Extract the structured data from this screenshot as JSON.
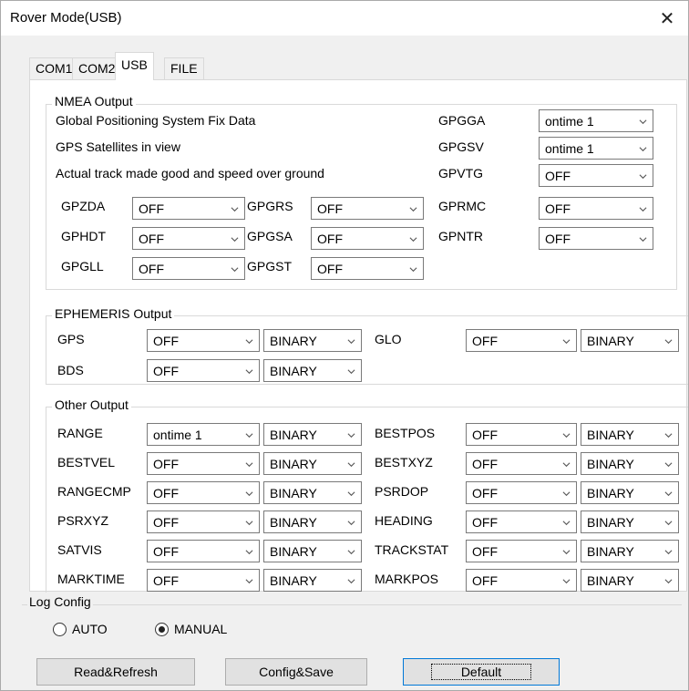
{
  "window": {
    "title": "Rover Mode(USB)",
    "close": "✕"
  },
  "tabs": [
    "COM1",
    "COM2",
    "USB",
    "FILE"
  ],
  "nmea": {
    "title": "NMEA Output",
    "rows": [
      {
        "desc": "Global Positioning System Fix Data",
        "code": "GPGGA",
        "value": "ontime 1"
      },
      {
        "desc": "GPS Satellites in view",
        "code": "GPGSV",
        "value": "ontime 1"
      },
      {
        "desc": "Actual track made good and speed over ground",
        "code": "GPVTG",
        "value": "OFF"
      }
    ],
    "grid": [
      {
        "name": "GPZDA",
        "value": "OFF"
      },
      {
        "name": "GPGRS",
        "value": "OFF"
      },
      {
        "name": "GPRMC",
        "value": "OFF"
      },
      {
        "name": "GPHDT",
        "value": "OFF"
      },
      {
        "name": "GPGSA",
        "value": "OFF"
      },
      {
        "name": "GPNTR",
        "value": "OFF"
      },
      {
        "name": "GPGLL",
        "value": "OFF"
      },
      {
        "name": "GPGST",
        "value": "OFF"
      }
    ]
  },
  "ephemeris": {
    "title": "EPHEMERIS Output",
    "items": [
      {
        "name": "GPS",
        "value": "OFF",
        "format": "BINARY"
      },
      {
        "name": "GLO",
        "value": "OFF",
        "format": "BINARY"
      },
      {
        "name": "BDS",
        "value": "OFF",
        "format": "BINARY"
      }
    ]
  },
  "other": {
    "title": "Other Output",
    "left": [
      {
        "name": "RANGE",
        "value": "ontime 1",
        "format": "BINARY"
      },
      {
        "name": "BESTVEL",
        "value": "OFF",
        "format": "BINARY"
      },
      {
        "name": "RANGECMP",
        "value": "OFF",
        "format": "BINARY"
      },
      {
        "name": "PSRXYZ",
        "value": "OFF",
        "format": "BINARY"
      },
      {
        "name": "SATVIS",
        "value": "OFF",
        "format": "BINARY"
      },
      {
        "name": "MARKTIME",
        "value": "OFF",
        "format": "BINARY"
      }
    ],
    "right": [
      {
        "name": "BESTPOS",
        "value": "OFF",
        "format": "BINARY"
      },
      {
        "name": "BESTXYZ",
        "value": "OFF",
        "format": "BINARY"
      },
      {
        "name": "PSRDOP",
        "value": "OFF",
        "format": "BINARY"
      },
      {
        "name": "HEADING",
        "value": "OFF",
        "format": "BINARY"
      },
      {
        "name": "TRACKSTAT",
        "value": "OFF",
        "format": "BINARY"
      },
      {
        "name": "MARKPOS",
        "value": "OFF",
        "format": "BINARY"
      }
    ]
  },
  "log_config": {
    "title": "Log Config",
    "auto": "AUTO",
    "manual": "MANUAL",
    "selected": "MANUAL"
  },
  "buttons": {
    "read": "Read&Refresh",
    "config": "Config&Save",
    "default": "Default"
  }
}
